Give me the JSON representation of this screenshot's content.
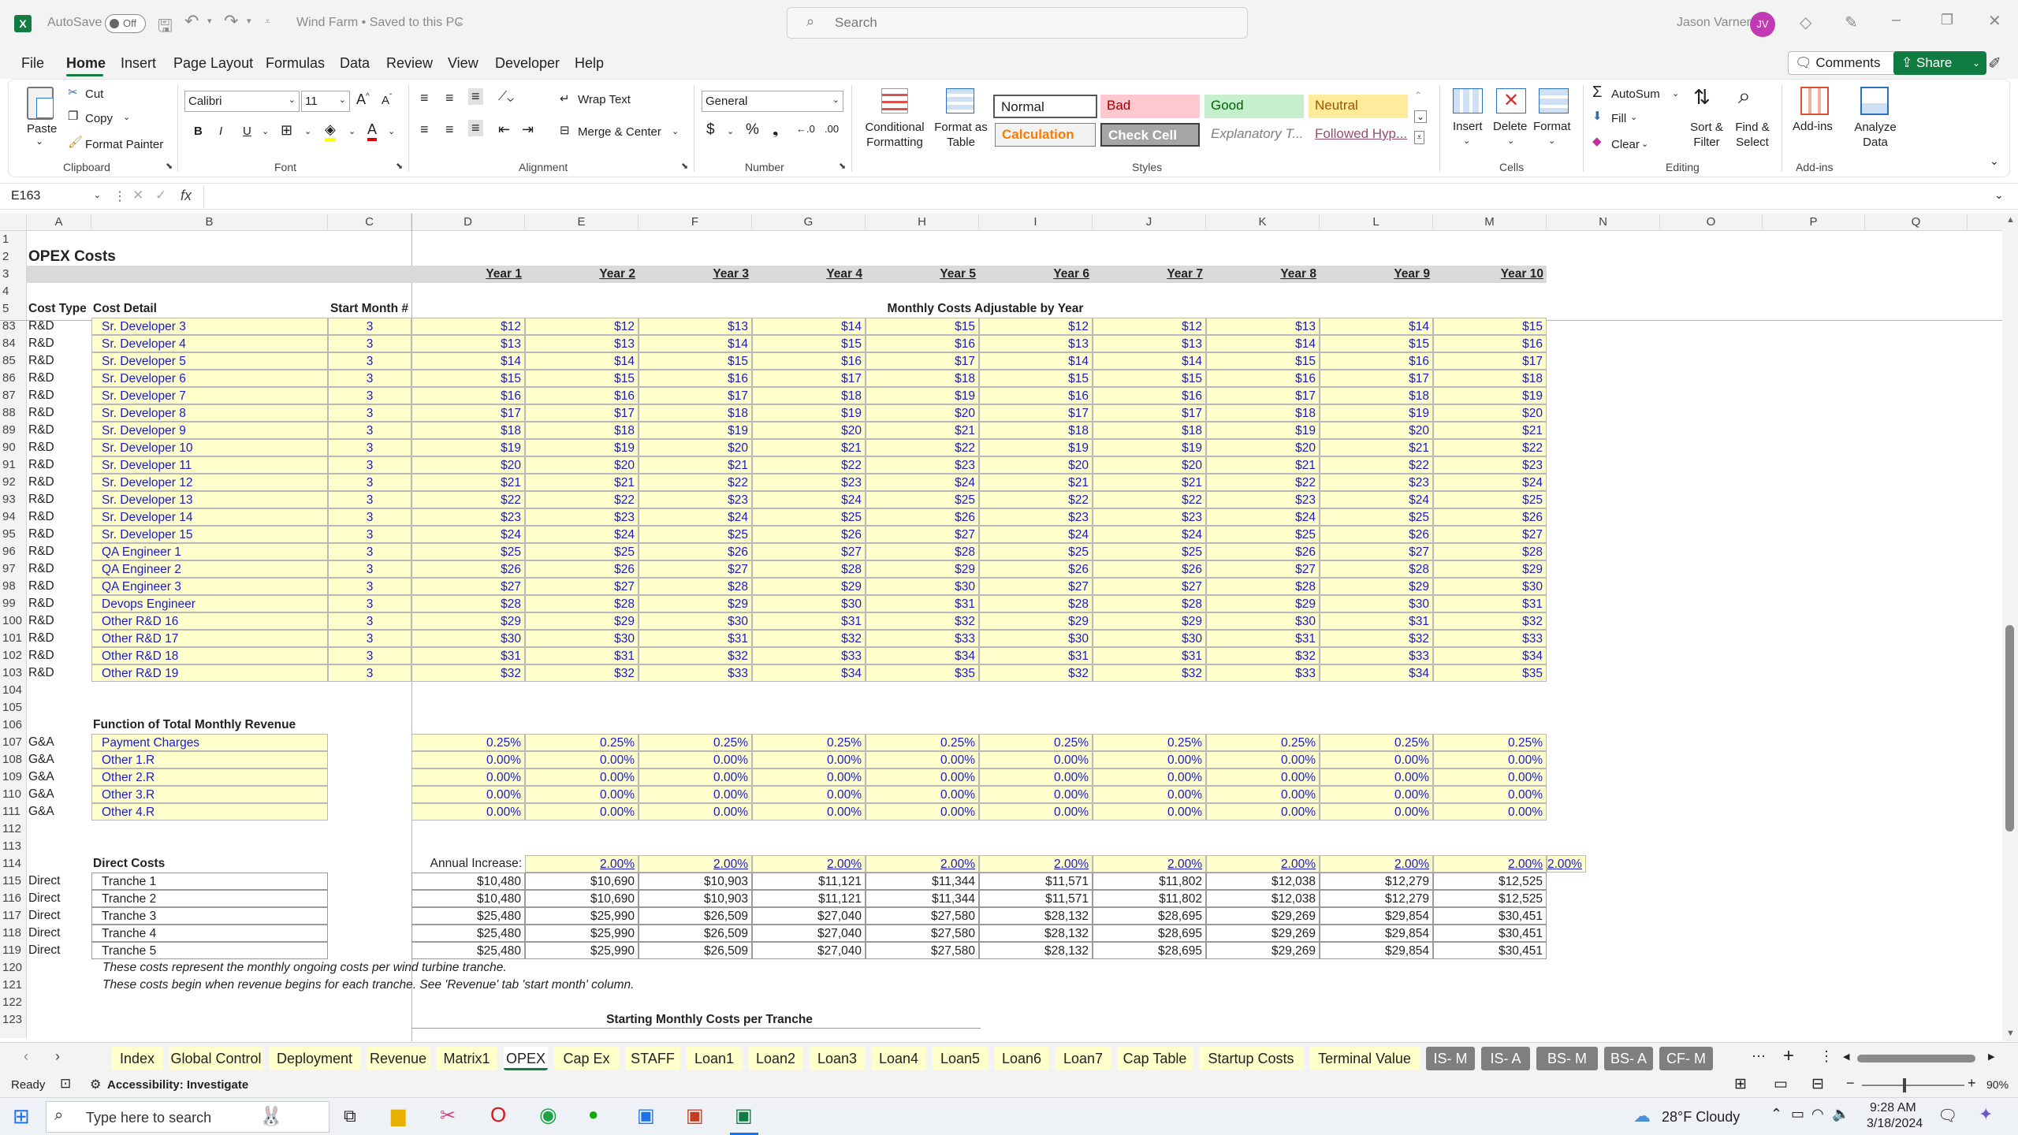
{
  "titlebar": {
    "autosave": "AutoSave",
    "toggle": "Off",
    "doc_title": "Wind Farm • Saved to this PC",
    "search_placeholder": "Search",
    "user": "Jason Varner",
    "initials": "JV"
  },
  "menu": [
    "File",
    "Home",
    "Insert",
    "Page Layout",
    "Formulas",
    "Data",
    "Review",
    "View",
    "Developer",
    "Help"
  ],
  "header_buttons": {
    "comments": "Comments",
    "share": "Share"
  },
  "ribbon": {
    "clipboard": {
      "paste": "Paste",
      "cut": "Cut",
      "copy": "Copy",
      "format_painter": "Format Painter",
      "label": "Clipboard"
    },
    "font": {
      "name": "Calibri",
      "size": "11",
      "bold": "B",
      "italic": "I",
      "underline": "U",
      "label": "Font"
    },
    "alignment": {
      "wrap": "Wrap Text",
      "merge": "Merge & Center",
      "label": "Alignment"
    },
    "number": {
      "format": "General",
      "label": "Number"
    },
    "styles": {
      "cond_format": "Conditional Formatting",
      "format_table": "Format as Table",
      "normal": "Normal",
      "bad": "Bad",
      "good": "Good",
      "neutral": "Neutral",
      "calculation": "Calculation",
      "check_cell": "Check Cell",
      "explanatory": "Explanatory T...",
      "followed": "Followed Hyp...",
      "label": "Styles"
    },
    "cells": {
      "insert": "Insert",
      "delete": "Delete",
      "format": "Format",
      "label": "Cells"
    },
    "editing": {
      "autosum": "AutoSum",
      "fill": "Fill",
      "clear": "Clear",
      "sort": "Sort & Filter",
      "find": "Find & Select",
      "label": "Editing"
    },
    "addins": {
      "addins": "Add-ins",
      "analyze": "Analyze Data",
      "label": "Add-ins"
    }
  },
  "formula_bar": {
    "name_box": "E163",
    "fx": "fx",
    "value": ""
  },
  "columns": [
    "A",
    "B",
    "C",
    "D",
    "E",
    "F",
    "G",
    "H",
    "I",
    "J",
    "K",
    "L",
    "M",
    "N",
    "O",
    "P",
    "Q"
  ],
  "sheet": {
    "title": "OPEX Costs",
    "years": [
      "Year 1",
      "Year 2",
      "Year 3",
      "Year 4",
      "Year 5",
      "Year 6",
      "Year 7",
      "Year 8",
      "Year 9",
      "Year 10"
    ],
    "hdr_cost_type": "Cost Type",
    "hdr_cost_detail": "Cost Detail",
    "hdr_start": "Start Month #",
    "hdr_monthly": "Monthly Costs Adjustable by Year",
    "rd_rows": [
      {
        "n": "83",
        "type": "R&D",
        "detail": "Sr. Developer 3",
        "start": "3",
        "vals": [
          "$12",
          "$12",
          "$13",
          "$14",
          "$15",
          "$12",
          "$12",
          "$13",
          "$14",
          "$15"
        ]
      },
      {
        "n": "84",
        "type": "R&D",
        "detail": "Sr. Developer 4",
        "start": "3",
        "vals": [
          "$13",
          "$13",
          "$14",
          "$15",
          "$16",
          "$13",
          "$13",
          "$14",
          "$15",
          "$16"
        ]
      },
      {
        "n": "85",
        "type": "R&D",
        "detail": "Sr. Developer 5",
        "start": "3",
        "vals": [
          "$14",
          "$14",
          "$15",
          "$16",
          "$17",
          "$14",
          "$14",
          "$15",
          "$16",
          "$17"
        ]
      },
      {
        "n": "86",
        "type": "R&D",
        "detail": "Sr. Developer 6",
        "start": "3",
        "vals": [
          "$15",
          "$15",
          "$16",
          "$17",
          "$18",
          "$15",
          "$15",
          "$16",
          "$17",
          "$18"
        ]
      },
      {
        "n": "87",
        "type": "R&D",
        "detail": "Sr. Developer 7",
        "start": "3",
        "vals": [
          "$16",
          "$16",
          "$17",
          "$18",
          "$19",
          "$16",
          "$16",
          "$17",
          "$18",
          "$19"
        ]
      },
      {
        "n": "88",
        "type": "R&D",
        "detail": "Sr. Developer 8",
        "start": "3",
        "vals": [
          "$17",
          "$17",
          "$18",
          "$19",
          "$20",
          "$17",
          "$17",
          "$18",
          "$19",
          "$20"
        ]
      },
      {
        "n": "89",
        "type": "R&D",
        "detail": "Sr. Developer 9",
        "start": "3",
        "vals": [
          "$18",
          "$18",
          "$19",
          "$20",
          "$21",
          "$18",
          "$18",
          "$19",
          "$20",
          "$21"
        ]
      },
      {
        "n": "90",
        "type": "R&D",
        "detail": "Sr. Developer 10",
        "start": "3",
        "vals": [
          "$19",
          "$19",
          "$20",
          "$21",
          "$22",
          "$19",
          "$19",
          "$20",
          "$21",
          "$22"
        ]
      },
      {
        "n": "91",
        "type": "R&D",
        "detail": "Sr. Developer 11",
        "start": "3",
        "vals": [
          "$20",
          "$20",
          "$21",
          "$22",
          "$23",
          "$20",
          "$20",
          "$21",
          "$22",
          "$23"
        ]
      },
      {
        "n": "92",
        "type": "R&D",
        "detail": "Sr. Developer 12",
        "start": "3",
        "vals": [
          "$21",
          "$21",
          "$22",
          "$23",
          "$24",
          "$21",
          "$21",
          "$22",
          "$23",
          "$24"
        ]
      },
      {
        "n": "93",
        "type": "R&D",
        "detail": "Sr. Developer 13",
        "start": "3",
        "vals": [
          "$22",
          "$22",
          "$23",
          "$24",
          "$25",
          "$22",
          "$22",
          "$23",
          "$24",
          "$25"
        ]
      },
      {
        "n": "94",
        "type": "R&D",
        "detail": "Sr. Developer 14",
        "start": "3",
        "vals": [
          "$23",
          "$23",
          "$24",
          "$25",
          "$26",
          "$23",
          "$23",
          "$24",
          "$25",
          "$26"
        ]
      },
      {
        "n": "95",
        "type": "R&D",
        "detail": "Sr. Developer 15",
        "start": "3",
        "vals": [
          "$24",
          "$24",
          "$25",
          "$26",
          "$27",
          "$24",
          "$24",
          "$25",
          "$26",
          "$27"
        ]
      },
      {
        "n": "96",
        "type": "R&D",
        "detail": "QA Engineer 1",
        "start": "3",
        "vals": [
          "$25",
          "$25",
          "$26",
          "$27",
          "$28",
          "$25",
          "$25",
          "$26",
          "$27",
          "$28"
        ]
      },
      {
        "n": "97",
        "type": "R&D",
        "detail": "QA Engineer 2",
        "start": "3",
        "vals": [
          "$26",
          "$26",
          "$27",
          "$28",
          "$29",
          "$26",
          "$26",
          "$27",
          "$28",
          "$29"
        ]
      },
      {
        "n": "98",
        "type": "R&D",
        "detail": "QA Engineer 3",
        "start": "3",
        "vals": [
          "$27",
          "$27",
          "$28",
          "$29",
          "$30",
          "$27",
          "$27",
          "$28",
          "$29",
          "$30"
        ]
      },
      {
        "n": "99",
        "type": "R&D",
        "detail": "Devops Engineer",
        "start": "3",
        "vals": [
          "$28",
          "$28",
          "$29",
          "$30",
          "$31",
          "$28",
          "$28",
          "$29",
          "$30",
          "$31"
        ]
      },
      {
        "n": "100",
        "type": "R&D",
        "detail": "Other R&D 16",
        "start": "3",
        "vals": [
          "$29",
          "$29",
          "$30",
          "$31",
          "$32",
          "$29",
          "$29",
          "$30",
          "$31",
          "$32"
        ]
      },
      {
        "n": "101",
        "type": "R&D",
        "detail": "Other R&D 17",
        "start": "3",
        "vals": [
          "$30",
          "$30",
          "$31",
          "$32",
          "$33",
          "$30",
          "$30",
          "$31",
          "$32",
          "$33"
        ]
      },
      {
        "n": "102",
        "type": "R&D",
        "detail": "Other R&D 18",
        "start": "3",
        "vals": [
          "$31",
          "$31",
          "$32",
          "$33",
          "$34",
          "$31",
          "$31",
          "$32",
          "$33",
          "$34"
        ]
      },
      {
        "n": "103",
        "type": "R&D",
        "detail": "Other R&D 19",
        "start": "3",
        "vals": [
          "$32",
          "$32",
          "$33",
          "$34",
          "$35",
          "$32",
          "$32",
          "$33",
          "$34",
          "$35"
        ]
      }
    ],
    "func_title": "Function of Total Monthly Revenue",
    "ga_rows": [
      {
        "n": "107",
        "type": "G&A",
        "detail": "Payment Charges",
        "vals": [
          "0.25%",
          "0.25%",
          "0.25%",
          "0.25%",
          "0.25%",
          "0.25%",
          "0.25%",
          "0.25%",
          "0.25%",
          "0.25%"
        ]
      },
      {
        "n": "108",
        "type": "G&A",
        "detail": "Other 1.R",
        "vals": [
          "0.00%",
          "0.00%",
          "0.00%",
          "0.00%",
          "0.00%",
          "0.00%",
          "0.00%",
          "0.00%",
          "0.00%",
          "0.00%"
        ]
      },
      {
        "n": "109",
        "type": "G&A",
        "detail": "Other 2.R",
        "vals": [
          "0.00%",
          "0.00%",
          "0.00%",
          "0.00%",
          "0.00%",
          "0.00%",
          "0.00%",
          "0.00%",
          "0.00%",
          "0.00%"
        ]
      },
      {
        "n": "110",
        "type": "G&A",
        "detail": "Other 3.R",
        "vals": [
          "0.00%",
          "0.00%",
          "0.00%",
          "0.00%",
          "0.00%",
          "0.00%",
          "0.00%",
          "0.00%",
          "0.00%",
          "0.00%"
        ]
      },
      {
        "n": "111",
        "type": "G&A",
        "detail": "Other 4.R",
        "vals": [
          "0.00%",
          "0.00%",
          "0.00%",
          "0.00%",
          "0.00%",
          "0.00%",
          "0.00%",
          "0.00%",
          "0.00%",
          "0.00%"
        ]
      }
    ],
    "direct_title": "Direct Costs",
    "annual_increase_label": "Annual Increase:",
    "annual_increase": [
      "2.00%",
      "2.00%",
      "2.00%",
      "2.00%",
      "2.00%",
      "2.00%",
      "2.00%",
      "2.00%",
      "2.00%",
      "2.00%"
    ],
    "direct_rows": [
      {
        "n": "115",
        "type": "Direct",
        "detail": "Tranche 1",
        "vals": [
          "$10,480",
          "$10,690",
          "$10,903",
          "$11,121",
          "$11,344",
          "$11,571",
          "$11,802",
          "$12,038",
          "$12,279",
          "$12,525"
        ]
      },
      {
        "n": "116",
        "type": "Direct",
        "detail": "Tranche 2",
        "vals": [
          "$10,480",
          "$10,690",
          "$10,903",
          "$11,121",
          "$11,344",
          "$11,571",
          "$11,802",
          "$12,038",
          "$12,279",
          "$12,525"
        ]
      },
      {
        "n": "117",
        "type": "Direct",
        "detail": "Tranche 3",
        "vals": [
          "$25,480",
          "$25,990",
          "$26,509",
          "$27,040",
          "$27,580",
          "$28,132",
          "$28,695",
          "$29,269",
          "$29,854",
          "$30,451"
        ]
      },
      {
        "n": "118",
        "type": "Direct",
        "detail": "Tranche 4",
        "vals": [
          "$25,480",
          "$25,990",
          "$26,509",
          "$27,040",
          "$27,580",
          "$28,132",
          "$28,695",
          "$29,269",
          "$29,854",
          "$30,451"
        ]
      },
      {
        "n": "119",
        "type": "Direct",
        "detail": "Tranche 5",
        "vals": [
          "$25,480",
          "$25,990",
          "$26,509",
          "$27,040",
          "$27,580",
          "$28,132",
          "$28,695",
          "$29,269",
          "$29,854",
          "$30,451"
        ]
      }
    ],
    "note1": "These costs represent the monthly ongoing costs per wind turbine tranche.",
    "note2": "These costs begin when revenue begins for each tranche. See 'Revenue' tab 'start month' column.",
    "starting_title": "Starting Monthly Costs per Tranche"
  },
  "tabs": [
    "Index",
    "Global Control",
    "Deployment",
    "Revenue",
    "Matrix1",
    "OPEX",
    "Cap Ex",
    "STAFF",
    "Loan1",
    "Loan2",
    "Loan3",
    "Loan4",
    "Loan5",
    "Loan6",
    "Loan7",
    "Cap Table",
    "Startup Costs",
    "Terminal Value",
    "IS- M",
    "IS- A",
    "BS- M",
    "BS- A",
    "CF- M"
  ],
  "active_tab": "OPEX",
  "status": {
    "ready": "Ready",
    "accessibility": "Accessibility: Investigate",
    "zoom": "90%"
  },
  "taskbar": {
    "search_placeholder": "Type here to search",
    "weather": "28°F  Cloudy",
    "time": "9:28 AM",
    "date": "3/18/2024"
  }
}
